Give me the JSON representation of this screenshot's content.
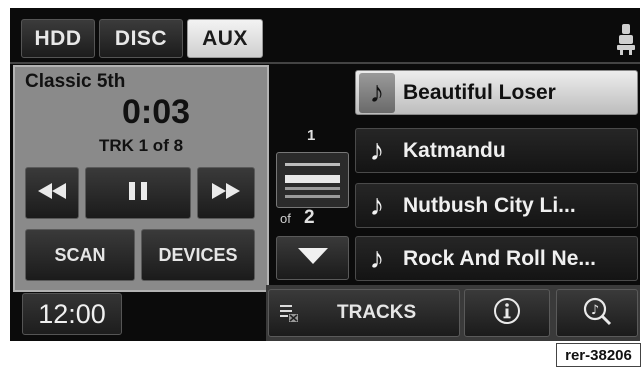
{
  "source_tabs": [
    {
      "label": "HDD",
      "active": false
    },
    {
      "label": "DISC",
      "active": false
    },
    {
      "label": "AUX",
      "active": true
    }
  ],
  "now_playing": {
    "title": "Classic 5th",
    "time": "0:03",
    "track_info": "TRK 1 of 8"
  },
  "controls": {
    "scan_label": "SCAN",
    "devices_label": "DEVICES"
  },
  "clock": "12:00",
  "pager": {
    "current_page": "1",
    "of_label": "of",
    "total_pages": "2"
  },
  "tracks": [
    {
      "label": "Beautiful Loser",
      "selected": true
    },
    {
      "label": "Katmandu",
      "selected": false
    },
    {
      "label": "Nutbush City Li...",
      "selected": false
    },
    {
      "label": "Rock And Roll Ne...",
      "selected": false
    }
  ],
  "bottom_bar": {
    "tracks_label": "TRACKS"
  },
  "reference_code": "rer-38206",
  "icons": [
    "seat-icon",
    "rewind-icon",
    "pause-icon",
    "fast-forward-icon",
    "music-note-icon",
    "down-arrow-icon",
    "tracks-list-icon",
    "info-icon",
    "music-search-icon"
  ]
}
